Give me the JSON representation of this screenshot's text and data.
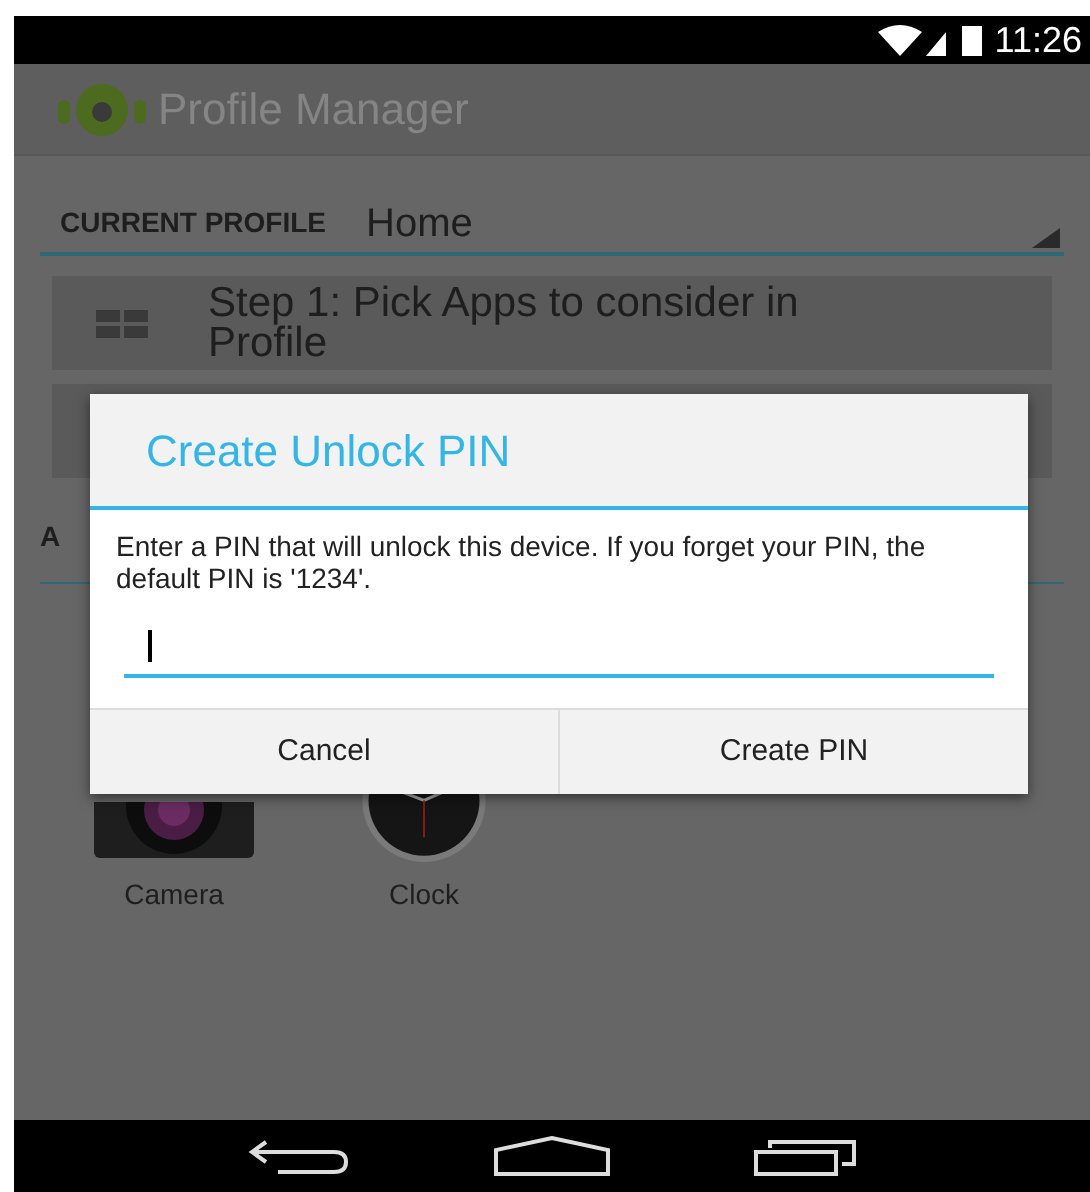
{
  "status_bar": {
    "time": "11:26"
  },
  "action_bar": {
    "title": "Profile Manager"
  },
  "current_profile": {
    "label": "CURRENT PROFILE",
    "value": "Home"
  },
  "steps": [
    {
      "label": "Step 1: Pick Apps to consider in Profile"
    }
  ],
  "section_header": "A",
  "apps": [
    {
      "name": "Camera",
      "kind": "camera"
    },
    {
      "name": "Clock",
      "kind": "clock"
    }
  ],
  "dialog": {
    "title": "Create Unlock PIN",
    "message": "Enter a PIN that will unlock this device. If you forget your PIN, the default PIN is '1234'.",
    "buttons": [
      "Cancel",
      "Create PIN"
    ]
  }
}
